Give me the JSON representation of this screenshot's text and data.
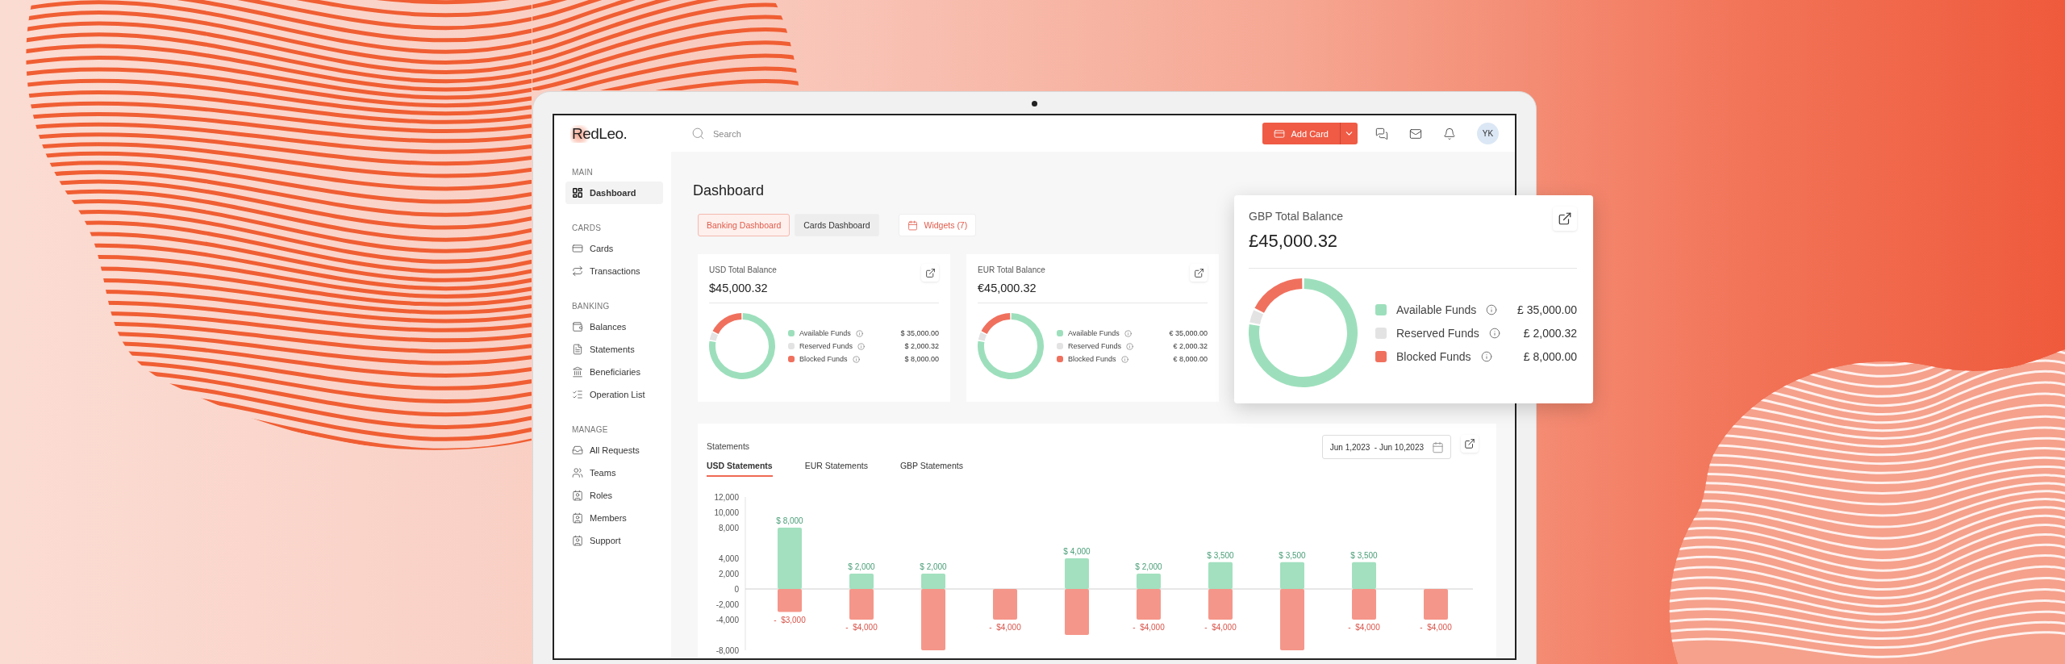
{
  "logo": "RedLeo.",
  "search": {
    "placeholder": "Search"
  },
  "header": {
    "add_button": "Add Card",
    "avatar": "YK"
  },
  "sidebar": [
    {
      "title": "MAIN",
      "items": [
        {
          "label": "Dashboard",
          "selected": true
        }
      ]
    },
    {
      "title": "CARDS",
      "items": [
        {
          "label": "Cards",
          "selected": false
        },
        {
          "label": "Transactions",
          "selected": false
        }
      ]
    },
    {
      "title": "BANKING",
      "items": [
        {
          "label": "Balances",
          "selected": false
        },
        {
          "label": "Statements",
          "selected": false
        },
        {
          "label": "Beneficiaries",
          "selected": false
        },
        {
          "label": "Operation List",
          "selected": false
        }
      ]
    },
    {
      "title": "MANAGE",
      "items": [
        {
          "label": "All Requests",
          "selected": false
        },
        {
          "label": "Teams",
          "selected": false
        },
        {
          "label": "Roles",
          "selected": false
        },
        {
          "label": "Members",
          "selected": false
        },
        {
          "label": "Support",
          "selected": false
        }
      ]
    }
  ],
  "page_title": "Dashboard",
  "dashboard_tabs": [
    {
      "label": "Banking Dashboard",
      "selected": true
    },
    {
      "label": "Cards Dashboard",
      "selected": false
    }
  ],
  "widgets_button": "Widgets (7)",
  "balance_cards": [
    {
      "title": "USD Total Balance",
      "total": "$45,000.32",
      "chart_data": {
        "type": "donut",
        "categories": [
          "Available Funds",
          "Reserved Funds",
          "Blocked Funds"
        ],
        "values": [
          35000,
          2000.32,
          8000
        ],
        "colors": [
          "#9ddfbc",
          "#e3e3e3",
          "#f0705e"
        ],
        "legend": "right",
        "value_labels": [
          "$ 35,000.00",
          "$ 2,000.32",
          "$ 8,000.00"
        ]
      }
    },
    {
      "title": "EUR Total Balance",
      "total": "€45,000.32",
      "chart_data": {
        "type": "donut",
        "categories": [
          "Available Funds",
          "Reserved Funds",
          "Blocked Funds"
        ],
        "values": [
          35000,
          2000.32,
          8000
        ],
        "colors": [
          "#9ddfbc",
          "#e3e3e3",
          "#f0705e"
        ],
        "legend": "right",
        "value_labels": [
          "€ 35,000.00",
          "€ 2,000.32",
          "€ 8,000.00"
        ]
      }
    }
  ],
  "floating_card": {
    "title": "GBP Total Balance",
    "total": "£45,000.32",
    "chart_data": {
      "type": "donut",
      "categories": [
        "Available Funds",
        "Reserved Funds",
        "Blocked Funds"
      ],
      "values": [
        35000,
        2000.32,
        8000
      ],
      "colors": [
        "#9ddfbc",
        "#e3e3e3",
        "#f0705e"
      ],
      "legend": "right",
      "value_labels": [
        "£ 35,000.00",
        "£ 2,000.32",
        "£ 8,000.00"
      ]
    }
  },
  "statements": {
    "title": "Statements",
    "date_range": "Jun 1,2023  - Jun 10,2023",
    "tabs": [
      {
        "label": "USD Statements",
        "selected": true
      },
      {
        "label": "EUR Statements",
        "selected": false
      },
      {
        "label": "GBP Statements",
        "selected": false
      }
    ],
    "chart_data": {
      "type": "bar",
      "stacked": true,
      "ylim": [
        -8000,
        12000
      ],
      "yticks": [
        {
          "value": 12000,
          "label": "12,000"
        },
        {
          "value": 10000,
          "label": "10,000"
        },
        {
          "value": 8000,
          "label": "8,000"
        },
        {
          "value": 4000,
          "label": "4,000"
        },
        {
          "value": 2000,
          "label": "2,000"
        },
        {
          "value": 0,
          "label": "0"
        },
        {
          "value": -2000,
          "label": "-2,000"
        },
        {
          "value": -4000,
          "label": "-4,000"
        },
        {
          "value": -8000,
          "label": "-8,000"
        }
      ],
      "series": [
        {
          "color": "#a2e0bf",
          "values": [
            8000,
            2000,
            2000,
            null,
            4000,
            2000,
            3500,
            3500,
            3500,
            null
          ],
          "value_labels": [
            "$ 8,000",
            "$ 2,000",
            "$ 2,000",
            null,
            "$ 4,000",
            "$ 2,000",
            "$ 3,500",
            "$ 3,500",
            "$ 3,500",
            null
          ]
        },
        {
          "color": "#f5968a",
          "values": [
            -3000,
            -4000,
            -8000,
            -4000,
            -6000,
            -4000,
            -4000,
            -8000,
            -4000,
            -4000
          ],
          "value_labels": [
            "-  $3,000",
            "-  $4,000",
            null,
            "-  $4,000",
            null,
            "-  $4,000",
            "-  $4,000",
            null,
            "-  $4,000",
            "-  $4,000"
          ]
        }
      ]
    }
  }
}
